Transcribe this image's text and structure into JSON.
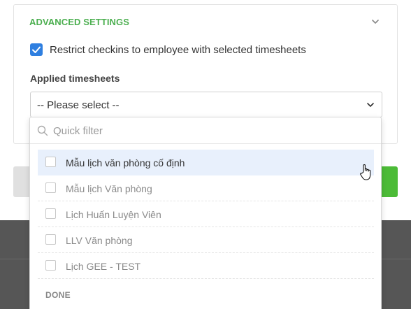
{
  "panel": {
    "title": "ADVANCED SETTINGS",
    "restrict_checkbox": {
      "label": "Restrict checkins to employee with selected timesheets",
      "checked": true
    },
    "field_label": "Applied timesheets",
    "select_value": "-- Please select --"
  },
  "dropdown": {
    "filter_placeholder": "Quick filter",
    "options": [
      {
        "label": "Mẫu lịch văn phòng cố định",
        "checked": false,
        "hovered": true
      },
      {
        "label": "Mẫu lịch Văn phòng",
        "checked": false,
        "hovered": false
      },
      {
        "label": "Lịch Huấn Luyện Viên",
        "checked": false,
        "hovered": false
      },
      {
        "label": "LLV Văn phòng",
        "checked": false,
        "hovered": false
      },
      {
        "label": "Lịch GEE - TEST",
        "checked": false,
        "hovered": false
      }
    ],
    "done_label": "DONE"
  },
  "colors": {
    "accent_green": "#4caf50",
    "checkbox_blue": "#2f7fe0",
    "hover_row": "#e8f0fc",
    "button_green": "#4cbb37",
    "backdrop_dark": "#565656"
  },
  "icons": [
    "chevron-down-icon",
    "check-icon",
    "search-icon",
    "hand-pointer-cursor-icon"
  ]
}
